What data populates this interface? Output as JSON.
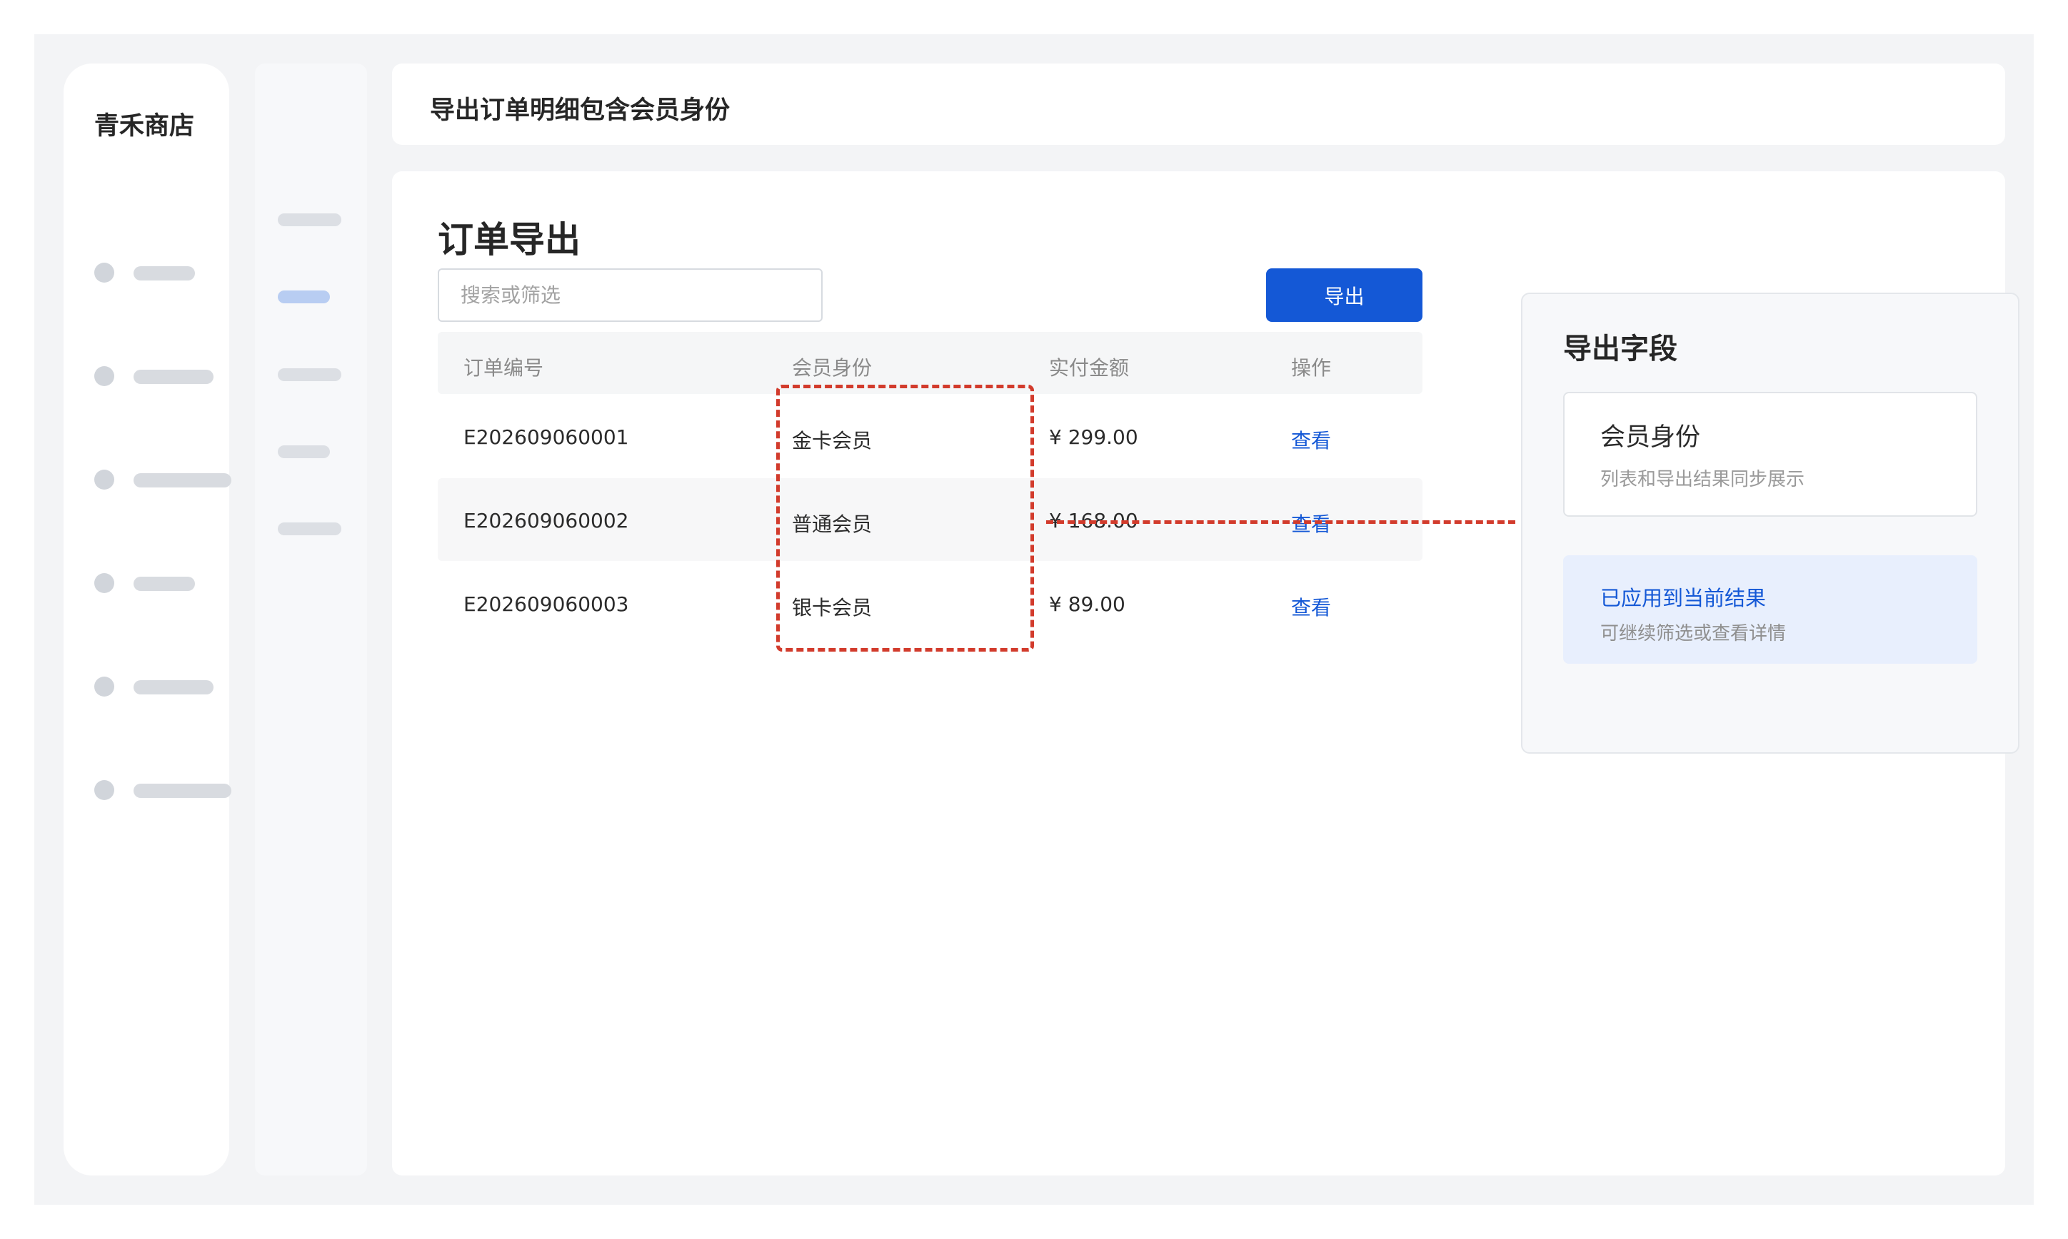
{
  "app": {
    "brand": "青禾商店"
  },
  "header": {
    "title": "导出订单明细包含会员身份"
  },
  "main": {
    "section_title": "订单导出",
    "search": {
      "placeholder": "搜索或筛选",
      "value": ""
    },
    "export_label": "导出",
    "table": {
      "columns": [
        "订单编号",
        "会员身份",
        "实付金额",
        "操作"
      ],
      "rows": [
        {
          "order_id": "E202609060001",
          "member": "金卡会员",
          "amount": "¥ 299.00",
          "action": "查看"
        },
        {
          "order_id": "E202609060002",
          "member": "普通会员",
          "amount": "¥ 168.00",
          "action": "查看"
        },
        {
          "order_id": "E202609060003",
          "member": "银卡会员",
          "amount": "¥ 89.00",
          "action": "查看"
        }
      ]
    }
  },
  "panel": {
    "title": "导出字段",
    "field": {
      "name": "会员身份",
      "desc": "列表和导出结果同步展示"
    },
    "applied": {
      "title": "已应用到当前结果",
      "desc": "可继续筛选或查看详情"
    }
  },
  "colors": {
    "accent": "#1458d6",
    "highlight": "#d23b2c",
    "applied_bg": "#e8effd"
  }
}
